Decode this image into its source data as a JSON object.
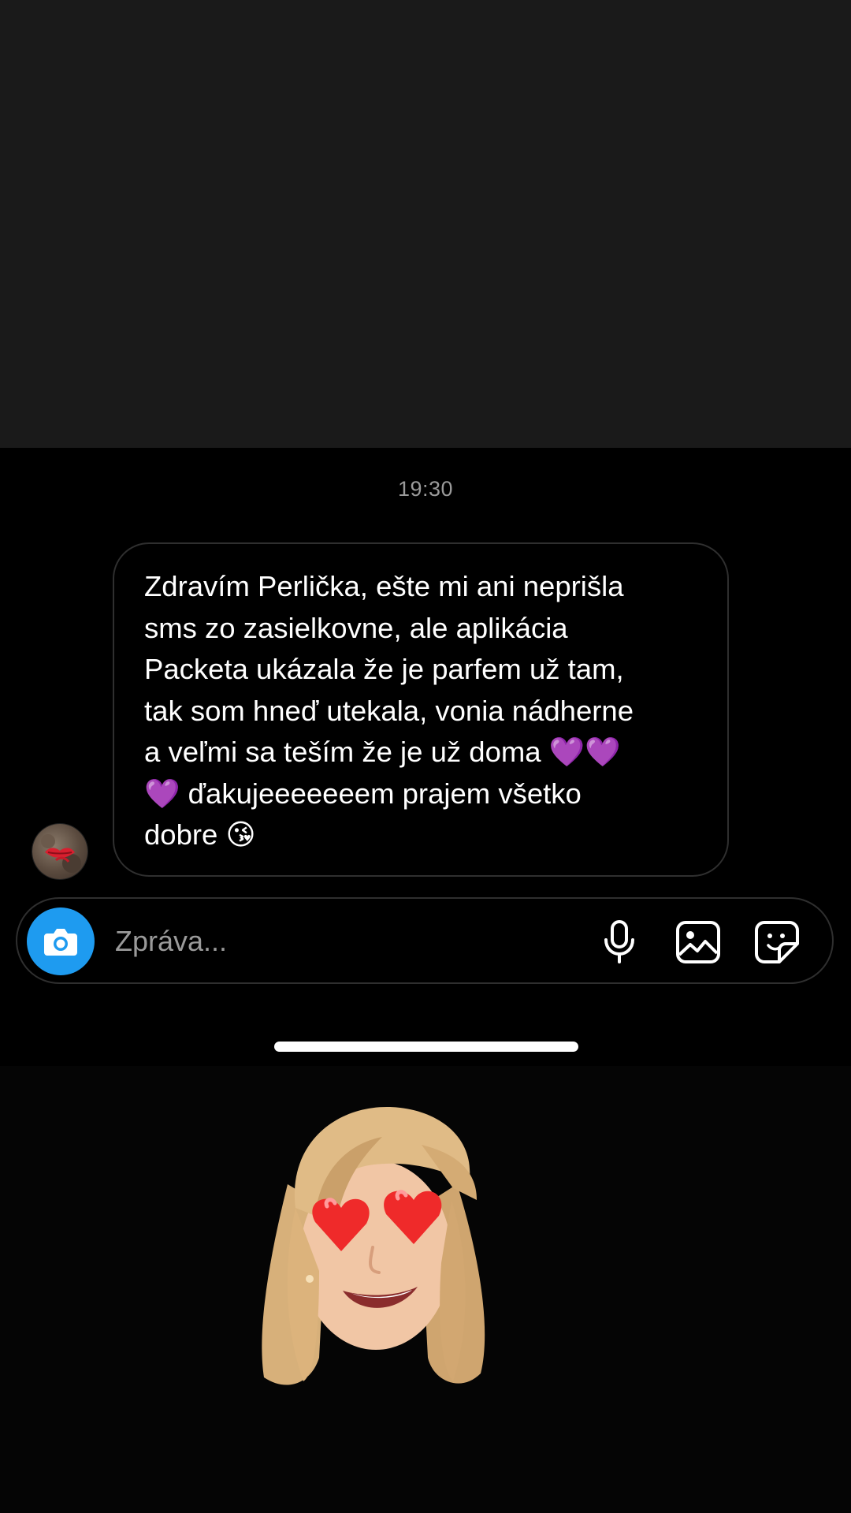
{
  "chat": {
    "timestamp": "19:30",
    "message": "Zdravím Perlička, ešte mi ani neprišla\nsms zo zasielkovne, ale aplikácia\nPacketa ukázala že je parfem už tam,\ntak som hneď utekala, vonia nádherne\na veľmi sa teším že je už doma 💜💜\n💜 ďakujeeeeeeem prajem všetko\ndobre 😘",
    "avatar_icon": "kiss-mark-avatar"
  },
  "composer": {
    "placeholder": "Zpráva...",
    "camera_icon": "camera-icon",
    "mic_icon": "microphone-icon",
    "gallery_icon": "gallery-icon",
    "sticker_icon": "sticker-icon"
  },
  "colors": {
    "background_top": "#1a1a1a",
    "background_chat": "#000000",
    "bubble_border": "#2f2f2f",
    "camera_button": "#1e9bf0",
    "timestamp_text": "#9a9a9a",
    "message_text": "#ffffff"
  },
  "sticker": {
    "icon": "memoji-heart-eyes-sticker"
  }
}
